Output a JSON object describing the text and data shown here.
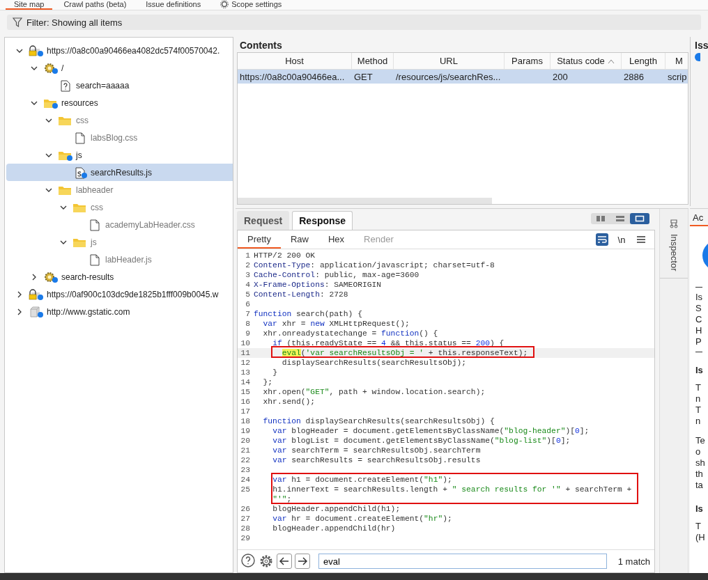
{
  "top_tabs": [
    {
      "label": "Site map",
      "selected": true,
      "kind": "plain"
    },
    {
      "label": "Crawl paths (beta)",
      "selected": false,
      "kind": "plain"
    },
    {
      "label": "Issue definitions",
      "selected": false,
      "kind": "plain"
    },
    {
      "label": "Scope settings",
      "selected": false,
      "kind": "settings"
    }
  ],
  "filter": {
    "label": "Filter: Showing all items"
  },
  "tree": [
    {
      "label": "https://0a8c00a90466ea4082dc574f00570042.",
      "kind": "host-secure",
      "dot": true,
      "requested": true,
      "expanded": true,
      "selected": false,
      "children": [
        {
          "label": "/",
          "kind": "gear",
          "dot": true,
          "requested": true,
          "expanded": true,
          "selected": false,
          "children": [
            {
              "label": "search=aaaaa",
              "kind": "query",
              "dot": false,
              "requested": true,
              "selected": false
            }
          ]
        },
        {
          "label": "resources",
          "kind": "folder",
          "dot": true,
          "requested": true,
          "expanded": true,
          "selected": false,
          "children": [
            {
              "label": "css",
              "kind": "folder",
              "dot": false,
              "requested": false,
              "expanded": true,
              "selected": false,
              "children": [
                {
                  "label": "labsBlog.css",
                  "kind": "file",
                  "dot": false,
                  "requested": false,
                  "selected": false
                }
              ]
            },
            {
              "label": "js",
              "kind": "folder",
              "dot": true,
              "requested": true,
              "expanded": true,
              "selected": false,
              "children": [
                {
                  "label": "searchResults.js",
                  "kind": "script",
                  "dot": true,
                  "requested": true,
                  "selected": true
                }
              ]
            },
            {
              "label": "labheader",
              "kind": "folder",
              "dot": false,
              "requested": false,
              "expanded": true,
              "selected": false,
              "children": [
                {
                  "label": "css",
                  "kind": "folder",
                  "dot": false,
                  "requested": false,
                  "expanded": true,
                  "selected": false,
                  "children": [
                    {
                      "label": "academyLabHeader.css",
                      "kind": "file",
                      "dot": false,
                      "requested": false,
                      "selected": false
                    }
                  ]
                },
                {
                  "label": "js",
                  "kind": "folder",
                  "dot": false,
                  "requested": false,
                  "expanded": true,
                  "selected": false,
                  "children": [
                    {
                      "label": "labHeader.js",
                      "kind": "file",
                      "dot": false,
                      "requested": false,
                      "selected": false
                    }
                  ]
                }
              ]
            }
          ]
        },
        {
          "label": "search-results",
          "kind": "gear",
          "dot": true,
          "requested": true,
          "expanded": false,
          "selected": false
        }
      ]
    },
    {
      "label": "https://0af900c103dc9de1825b1fff009b0045.w",
      "kind": "host-secure",
      "dot": true,
      "requested": true,
      "expanded": false,
      "selected": false
    },
    {
      "label": "http://www.gstatic.com",
      "kind": "host",
      "dot": true,
      "requested": true,
      "expanded": false,
      "selected": false
    }
  ],
  "contents": {
    "title": "Contents",
    "columns": [
      {
        "label": "Host",
        "sorted": false
      },
      {
        "label": "Method",
        "sorted": false
      },
      {
        "label": "URL",
        "sorted": false
      },
      {
        "label": "Params",
        "sorted": false
      },
      {
        "label": "Status code",
        "sorted": true
      },
      {
        "label": "Length",
        "sorted": false
      },
      {
        "label": "M",
        "sorted": false
      }
    ],
    "rows": [
      {
        "selected": true,
        "cells": [
          "https://0a8c00a90466ea...",
          "GET",
          "/resources/js/searchRes...",
          null,
          "200",
          "2886",
          "scrip"
        ]
      }
    ]
  },
  "issues_panel": {
    "title": "Iss"
  },
  "editor": {
    "tabs": [
      {
        "label": "Request",
        "selected": false
      },
      {
        "label": "Response",
        "selected": true
      }
    ],
    "layout_buttons": [
      {
        "kind": "columns",
        "selected": false
      },
      {
        "kind": "rows",
        "selected": false
      },
      {
        "kind": "single",
        "selected": true
      }
    ],
    "subtabs": [
      {
        "label": "Pretty",
        "selected": true,
        "disabled": false
      },
      {
        "label": "Raw",
        "selected": false,
        "disabled": false
      },
      {
        "label": "Hex",
        "selected": false,
        "disabled": false
      },
      {
        "label": "Render",
        "selected": false,
        "disabled": true
      }
    ],
    "tools": [
      {
        "kind": "wrap",
        "selected": true
      },
      {
        "kind": "text",
        "label": "\\n",
        "selected": false
      },
      {
        "kind": "menu",
        "selected": false
      }
    ],
    "lines": [
      {
        "number": "1",
        "segments": [
          {
            "kind": "plain",
            "text": "HTTP/2 200 OK"
          }
        ]
      },
      {
        "number": "2",
        "segments": [
          {
            "kind": "key",
            "text": "Content-Type"
          },
          {
            "kind": "plain",
            "text": ": application/javascript; charset=utf-8"
          }
        ]
      },
      {
        "number": "3",
        "segments": [
          {
            "kind": "key",
            "text": "Cache-Control"
          },
          {
            "kind": "plain",
            "text": ": public, max-age=3600"
          }
        ]
      },
      {
        "number": "4",
        "segments": [
          {
            "kind": "key",
            "text": "X-Frame-Options"
          },
          {
            "kind": "plain",
            "text": ": SAMEORIGIN"
          }
        ]
      },
      {
        "number": "5",
        "segments": [
          {
            "kind": "key",
            "text": "Content-Length"
          },
          {
            "kind": "plain",
            "text": ": 2728"
          }
        ]
      },
      {
        "number": "6"
      },
      {
        "number": "7",
        "segments": [
          {
            "kind": "kw",
            "text": "function"
          },
          {
            "kind": "plain",
            "text": " search(path) {"
          }
        ]
      },
      {
        "number": "8",
        "segments": [
          {
            "kind": "kw",
            "text": "  var"
          },
          {
            "kind": "plain",
            "text": " xhr = "
          },
          {
            "kind": "kw",
            "text": "new"
          },
          {
            "kind": "plain",
            "text": " XMLHttpRequest();"
          }
        ]
      },
      {
        "number": "9",
        "segments": [
          {
            "kind": "plain",
            "text": "  xhr.onreadystatechange = "
          },
          {
            "kind": "kw",
            "text": "function"
          },
          {
            "kind": "plain",
            "text": "() {"
          }
        ]
      },
      {
        "number": "10",
        "segments": [
          {
            "kind": "kw",
            "text": "    if"
          },
          {
            "kind": "plain",
            "text": " (this.readyState == "
          },
          {
            "kind": "num",
            "text": "4"
          },
          {
            "kind": "plain",
            "text": " && this.status == "
          },
          {
            "kind": "num",
            "text": "200"
          },
          {
            "kind": "plain",
            "text": ") {"
          }
        ]
      },
      {
        "number": "11",
        "current": true,
        "boxed": true,
        "segments": [
          {
            "kind": "match",
            "text": "      eval"
          },
          {
            "kind": "plain",
            "text": "("
          },
          {
            "kind": "str",
            "text": "'var searchResultsObj = '"
          },
          {
            "kind": "plain",
            "text": " + this.responseText);"
          }
        ]
      },
      {
        "number": "12",
        "segments": [
          {
            "kind": "plain",
            "text": "      displaySearchResults(searchResultsObj);"
          }
        ]
      },
      {
        "number": "13",
        "segments": [
          {
            "kind": "plain",
            "text": "    }"
          }
        ]
      },
      {
        "number": "14",
        "segments": [
          {
            "kind": "plain",
            "text": "  };"
          }
        ]
      },
      {
        "number": "15",
        "segments": [
          {
            "kind": "plain",
            "text": "  xhr.open("
          },
          {
            "kind": "str",
            "text": "\"GET\""
          },
          {
            "kind": "plain",
            "text": ", path + window.location.search);"
          }
        ]
      },
      {
        "number": "16",
        "segments": [
          {
            "kind": "plain",
            "text": "  xhr.send();"
          }
        ]
      },
      {
        "number": "17"
      },
      {
        "number": "18",
        "segments": [
          {
            "kind": "kw",
            "text": "  function"
          },
          {
            "kind": "plain",
            "text": " displaySearchResults(searchResultsObj) {"
          }
        ]
      },
      {
        "number": "19",
        "segments": [
          {
            "kind": "kw",
            "text": "    var"
          },
          {
            "kind": "plain",
            "text": " blogHeader = document.getElementsByClassName("
          },
          {
            "kind": "str",
            "text": "\"blog-header\""
          },
          {
            "kind": "plain",
            "text": ")["
          },
          {
            "kind": "num",
            "text": "0"
          },
          {
            "kind": "plain",
            "text": "];"
          }
        ]
      },
      {
        "number": "20",
        "segments": [
          {
            "kind": "kw",
            "text": "    var"
          },
          {
            "kind": "plain",
            "text": " blogList = document.getElementsByClassName("
          },
          {
            "kind": "str",
            "text": "\"blog-list\""
          },
          {
            "kind": "plain",
            "text": ")["
          },
          {
            "kind": "num",
            "text": "0"
          },
          {
            "kind": "plain",
            "text": "];"
          }
        ]
      },
      {
        "number": "21",
        "segments": [
          {
            "kind": "kw",
            "text": "    var"
          },
          {
            "kind": "plain",
            "text": " searchTerm = searchResultsObj.searchTerm"
          }
        ]
      },
      {
        "number": "22",
        "segments": [
          {
            "kind": "kw",
            "text": "    var"
          },
          {
            "kind": "plain",
            "text": " searchResults = searchResultsObj.results"
          }
        ]
      },
      {
        "number": "23"
      },
      {
        "number": "24",
        "boxed": true,
        "segments": [
          {
            "kind": "kw",
            "text": "    var"
          },
          {
            "kind": "plain",
            "text": " h1 = document.createElement("
          },
          {
            "kind": "str",
            "text": "\"h1\""
          },
          {
            "kind": "plain",
            "text": ");"
          }
        ]
      },
      {
        "number": "25",
        "boxed": true,
        "segments": [
          {
            "kind": "plain",
            "text": "    h1.innerText = searchResults.length + "
          },
          {
            "kind": "str",
            "text": "\" search results for '\""
          },
          {
            "kind": "plain",
            "text": " + searchTerm +"
          }
        ]
      },
      {
        "boxed": true,
        "segments": [
          {
            "kind": "str",
            "text": "    \"'\""
          },
          {
            "kind": "plain",
            "text": ";"
          }
        ]
      },
      {
        "number": "26",
        "segments": [
          {
            "kind": "plain",
            "text": "    blogHeader.appendChild(h1);"
          }
        ]
      },
      {
        "number": "27",
        "segments": [
          {
            "kind": "kw",
            "text": "    var"
          },
          {
            "kind": "plain",
            "text": " hr = document.createElement("
          },
          {
            "kind": "str",
            "text": "\"hr\""
          },
          {
            "kind": "plain",
            "text": ");"
          }
        ]
      },
      {
        "number": "28",
        "segments": [
          {
            "kind": "plain",
            "text": "    blogHeader.appendChild(hr)"
          }
        ]
      },
      {
        "number": "29"
      }
    ],
    "search": {
      "value": "eval",
      "result": "1 match"
    }
  },
  "inspector": {
    "label": "Inspector"
  },
  "advisory_panel": {
    "tab": "Ac",
    "summary_lines": [
      "Is",
      "S",
      "C",
      "H",
      "P"
    ],
    "sections": [
      {
        "heading": "Is",
        "paragraphs": [
          [
            "T",
            "n",
            "T",
            "n"
          ],
          [
            "Te",
            "o",
            "sh",
            "th",
            "ta"
          ]
        ]
      },
      {
        "heading": "Is",
        "paragraphs": [
          [
            "T",
            "(H"
          ]
        ]
      }
    ]
  }
}
